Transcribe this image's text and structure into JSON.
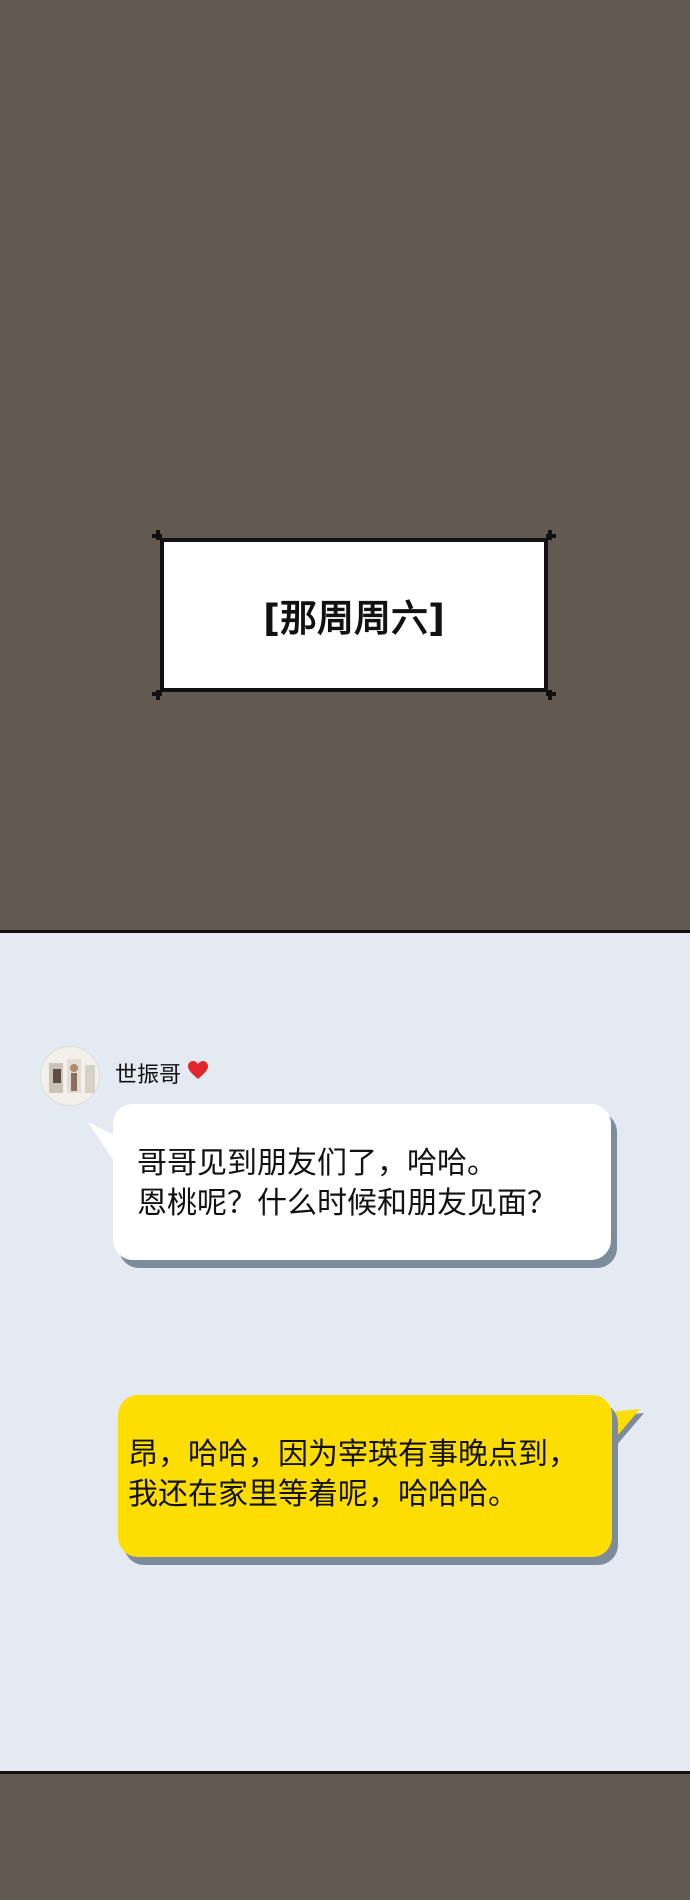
{
  "caption": {
    "text": "[那周周六]"
  },
  "chat": {
    "sender": {
      "name": "世振哥",
      "badge_icon": "heart-icon",
      "badge_color": "#e1262c"
    },
    "messages": [
      {
        "direction": "incoming",
        "text": "哥哥见到朋友们了，哈哈。\n恩桃呢？什么时候和朋友见面？",
        "bubble_color": "#ffffff"
      },
      {
        "direction": "outgoing",
        "text": "昂，哈哈，因为宰瑛有事晚点到，\n我还在家里等着呢，哈哈哈。",
        "bubble_color": "#fede00"
      }
    ]
  },
  "colors": {
    "panel_dark": "#625a50",
    "chat_background": "#e4eaf1",
    "bubble_shadow": "#7d8c9c"
  }
}
